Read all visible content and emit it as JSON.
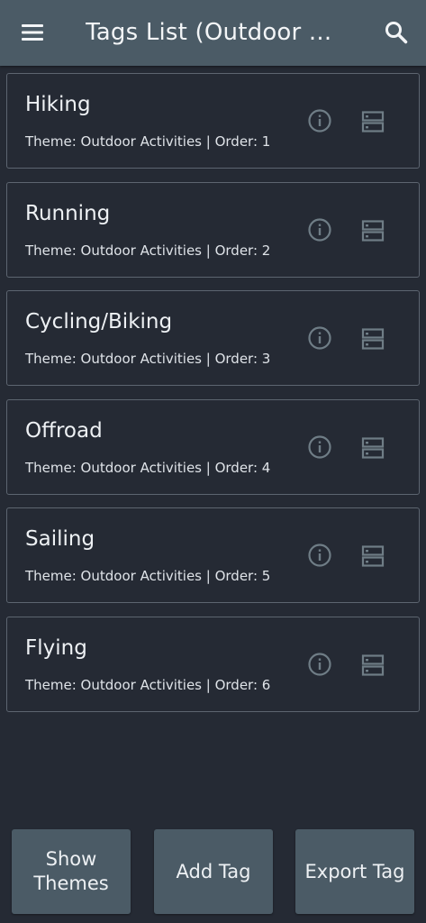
{
  "appbar": {
    "title": "Tags List (Outdoor ...",
    "menu_icon": "hamburger-menu-icon",
    "search_icon": "search-icon",
    "color": "#4b5b66"
  },
  "tags": [
    {
      "name": "Hiking",
      "meta": "Theme: Outdoor Activities | Order: 1"
    },
    {
      "name": "Running",
      "meta": "Theme: Outdoor Activities | Order: 2"
    },
    {
      "name": "Cycling/Biking",
      "meta": "Theme: Outdoor Activities | Order: 3"
    },
    {
      "name": "Offroad",
      "meta": "Theme: Outdoor Activities | Order: 4"
    },
    {
      "name": "Sailing",
      "meta": "Theme: Outdoor Activities | Order: 5"
    },
    {
      "name": "Flying",
      "meta": "Theme: Outdoor Activities | Order: 6"
    }
  ],
  "row_icons": [
    "info-icon",
    "storage-icon"
  ],
  "actions": {
    "show_themes": "Show Themes",
    "add_tag": "Add Tag",
    "export_tag": "Export Tag"
  },
  "colors": {
    "background": "#252a34",
    "card_border": "#5d6570",
    "icon": "#6f7d86",
    "button": "#4b5b66"
  }
}
